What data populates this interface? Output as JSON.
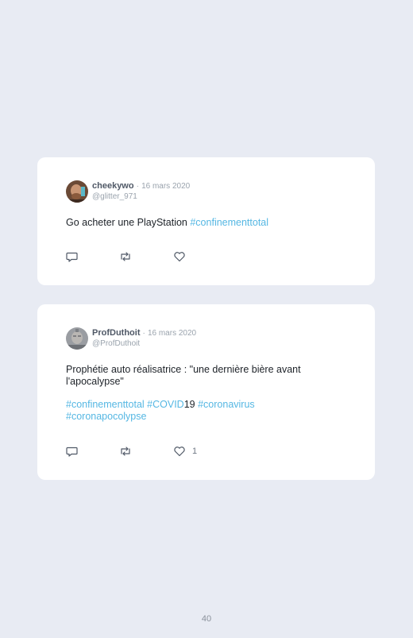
{
  "tweets": [
    {
      "author": "cheekywo",
      "separator": "·",
      "date": "16 mars 2020",
      "handle": "@glitter_971",
      "text_plain": "Go acheter une PlayStation ",
      "text_tag": "#confinementtotal",
      "like_count": ""
    },
    {
      "author": "ProfDuthoit",
      "separator": "·",
      "date": "16 mars 2020",
      "handle": "@ProfDuthoit",
      "text": "Prophétie auto réalisatrice : \"une dernière bière avant l'apocalypse\"",
      "hashtags": {
        "tag1": "#confinementtotal",
        "tag2": "#COVID",
        "tag2_suffix": "19",
        "tag3": "#coronavirus",
        "tag4": "#coronapocolypse"
      },
      "like_count": "1"
    }
  ],
  "icons": {
    "reply": "reply-icon",
    "retweet": "retweet-icon",
    "like": "heart-icon"
  },
  "colors": {
    "background": "#e8ebf3",
    "card": "#ffffff",
    "hashtag": "#55b7e3",
    "name": "#4f5866",
    "muted": "#9aa3ad"
  },
  "page_number": "40"
}
